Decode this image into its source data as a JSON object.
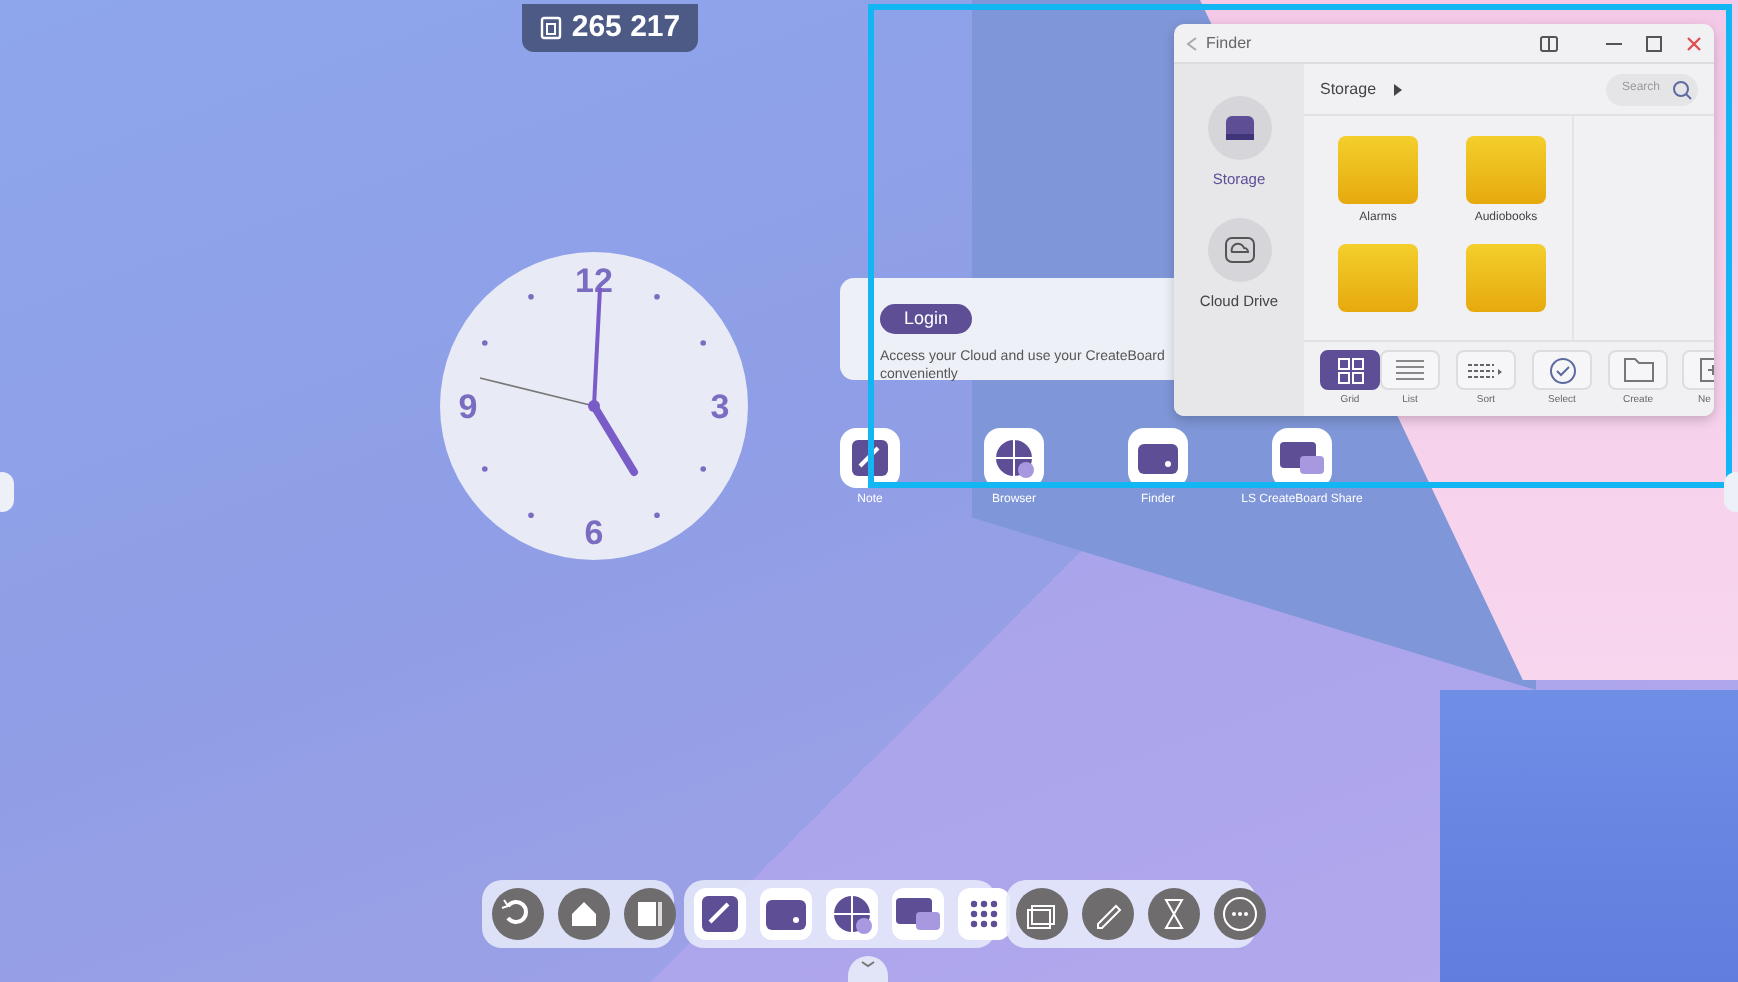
{
  "counter": {
    "text": "265 217"
  },
  "clock": {
    "numerals": [
      "12",
      "3",
      "6",
      "9"
    ]
  },
  "login_card": {
    "button": "Login",
    "text": "Access your Cloud and use your CreateBoard conveniently"
  },
  "desktop_apps": [
    {
      "label": "Note",
      "kind": "note"
    },
    {
      "label": "Browser",
      "kind": "browser"
    },
    {
      "label": "Finder",
      "kind": "finder"
    },
    {
      "label": "LS CreateBoard Share",
      "kind": "share"
    }
  ],
  "finder": {
    "title": "Finder",
    "sidebar": [
      {
        "label": "Storage",
        "kind": "storage",
        "selected": true
      },
      {
        "label": "Cloud Drive",
        "kind": "cloud",
        "selected": false
      }
    ],
    "path": "Storage",
    "search": {
      "placeholder": "Search"
    },
    "folders": [
      {
        "kind": "labeled",
        "name": "Alarms"
      },
      {
        "kind": "labeled",
        "name": "Audiobooks"
      },
      {
        "kind": "cut"
      },
      {
        "kind": "cut"
      }
    ],
    "toolbar": [
      {
        "label": "Grid",
        "kind": "grid",
        "selected": true
      },
      {
        "label": "List",
        "kind": "list",
        "selected": false
      },
      {
        "label": "Sort",
        "kind": "sort",
        "selected": false
      },
      {
        "label": "Select",
        "kind": "select",
        "selected": false
      },
      {
        "label": "Create",
        "kind": "create",
        "selected": false
      },
      {
        "label": "Ne",
        "kind": "new",
        "selected": false
      }
    ]
  }
}
